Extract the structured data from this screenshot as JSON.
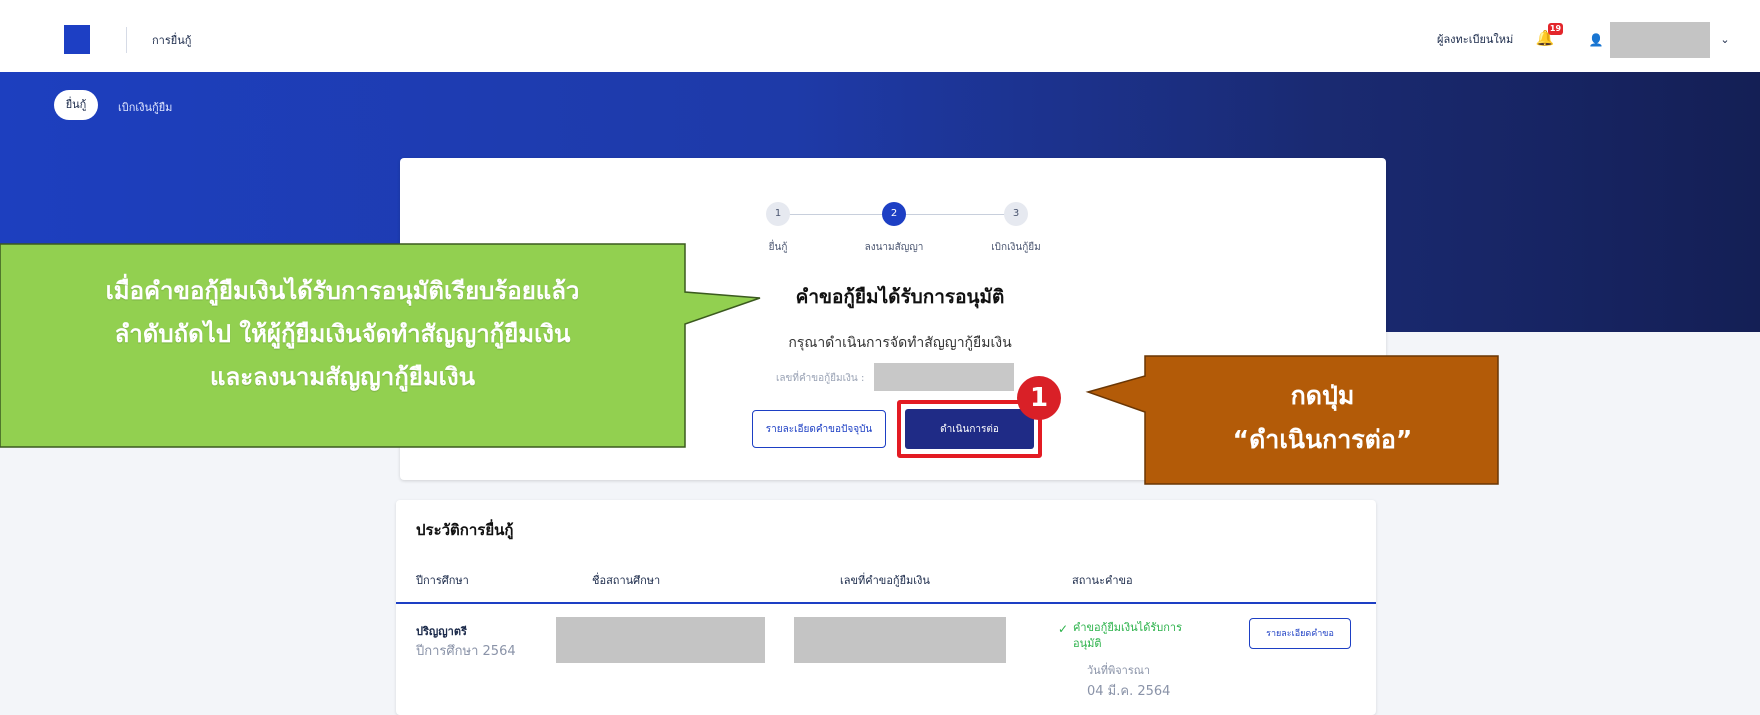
{
  "topbar": {
    "nav_label": "การยื่นกู้",
    "register_label": "ผู้ลงทะเบียนใหม่",
    "notification_count": "19",
    "chevron": "⌄",
    "bell_glyph": "🔔",
    "user_glyph": "👤"
  },
  "subnav": {
    "active_pill": "ยื่นกู้",
    "second_item": "เบิกเงินกู้ยืม"
  },
  "stepper": {
    "steps": [
      {
        "number": "1",
        "label": "ยื่นกู้",
        "state": "inactive"
      },
      {
        "number": "2",
        "label": "ลงนามสัญญา",
        "state": "active"
      },
      {
        "number": "3",
        "label": "เบิกเงินกู้ยืม",
        "state": "inactive"
      }
    ]
  },
  "status_card": {
    "title": "คำขอกู้ยืมได้รับการอนุมัติ",
    "subtitle": "กรุณาดำเนินการจัดทำสัญญากู้ยืมเงิน",
    "request_number_label": "เลขที่คำขอกู้ยืมเงิน :",
    "details_button": "รายละเอียดคำขอปัจจุบัน",
    "continue_button": "ดำเนินการต่อ"
  },
  "annotations": {
    "green_callout": [
      "เมื่อคำขอกู้ยืมเงินได้รับการอนุมัติเรียบร้อยแล้ว",
      "ลำดับถัดไป ให้ผู้กู้ยืมเงินจัดทำสัญญากู้ยืมเงิน",
      "และลงนามสัญญากู้ยืมเงิน"
    ],
    "marker_number": "1",
    "brown_callout": [
      "กดปุ่ม",
      "“ดำเนินการต่อ”"
    ],
    "colors": {
      "green": "#92d050",
      "brown": "#b35b08",
      "highlight_red": "#e31b23"
    }
  },
  "history": {
    "title": "ประวัติการยื่นกู้",
    "columns": [
      "ปีการศึกษา",
      "ชื่อสถานศึกษา",
      "เลขที่คำขอกู้ยืมเงิน",
      "สถานะคำขอ"
    ],
    "rows": [
      {
        "degree": "ปริญญาตรี",
        "academic_year": "ปีการศึกษา 2564",
        "status_line1": "คำขอกู้ยืมเงินได้รับการ",
        "status_line2": "อนุมัติ",
        "status_date_label": "วันที่พิจารณา",
        "status_date": "04 มี.ค. 2564",
        "detail_button": "รายละเอียดคำขอ"
      }
    ]
  },
  "colors": {
    "primary": "#1d3fc4",
    "button_dark": "#1f2b86",
    "success": "#2bb24a"
  }
}
